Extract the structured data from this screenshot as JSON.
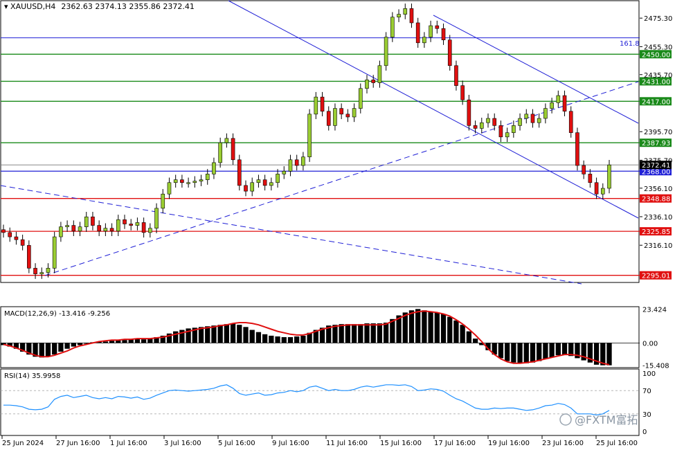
{
  "header": {
    "symbol": "XAUUSD,H4",
    "ohlc": "2362.63 2374.13 2355.86 2372.41"
  },
  "price_axis": {
    "ticks": [
      "2475.30",
      "2455.30",
      "2435.70",
      "2395.70",
      "2375.70",
      "2356.10",
      "2336.10",
      "2316.10"
    ],
    "tick_values": [
      2475.3,
      2455.3,
      2435.7,
      2395.7,
      2375.7,
      2356.1,
      2336.1,
      2316.1
    ]
  },
  "levels": [
    {
      "label": "2450.00",
      "value": 2450.0,
      "color": "#1a8a1a"
    },
    {
      "label": "2431.00",
      "value": 2431.0,
      "color": "#1a8a1a"
    },
    {
      "label": "2417.00",
      "value": 2417.0,
      "color": "#1a8a1a"
    },
    {
      "label": "2387.93",
      "value": 2387.93,
      "color": "#1a8a1a"
    },
    {
      "label": "2368.00",
      "value": 2368.0,
      "color": "#1f1fd6"
    },
    {
      "label": "2348.88",
      "value": 2348.88,
      "color": "#e01010"
    },
    {
      "label": "2325.85",
      "value": 2325.85,
      "color": "#e01010"
    },
    {
      "label": "2295.01",
      "value": 2295.01,
      "color": "#e01010"
    }
  ],
  "current_price": {
    "label": "2372.41",
    "value": 2372.41
  },
  "fib": {
    "label": "161.8",
    "value": 2461.5
  },
  "macd": {
    "label": "MACD(12,26,9) -13.416 -9.256",
    "ticks": [
      "23.424",
      "0.00",
      "-15.408"
    ],
    "tick_values": [
      23.424,
      0,
      -15.408
    ]
  },
  "rsi": {
    "label": "RSI(14) 35.9958",
    "ticks": [
      "100",
      "70",
      "30",
      "0"
    ],
    "tick_values": [
      100,
      70,
      30,
      0
    ],
    "color": "#1e90ff"
  },
  "time_axis": {
    "labels": [
      "25 Jun 2024",
      "27 Jun 16:00",
      "1 Jul 16:00",
      "3 Jul 16:00",
      "5 Jul 16:00",
      "9 Jul 16:00",
      "11 Jul 16:00",
      "15 Jul 16:00",
      "17 Jul 16:00",
      "19 Jul 16:00",
      "23 Jul 16:00",
      "25 Jul 16:00"
    ]
  },
  "watermark": "@FXTM富拓",
  "colors": {
    "bull": "#9acd32",
    "bear": "#e01010",
    "trendline": "#1f1fd6",
    "signal": "#e01010",
    "hist": "#000000"
  },
  "chart_data": {
    "type": "candlestick",
    "price_close": [
      2325,
      2322,
      2320,
      2316,
      2300,
      2296,
      2297,
      2300,
      2322,
      2329,
      2330,
      2326,
      2329,
      2336,
      2330,
      2326,
      2328,
      2326,
      2334,
      2331,
      2330,
      2332,
      2325,
      2328,
      2342,
      2352,
      2360,
      2362,
      2360,
      2360,
      2361,
      2362,
      2366,
      2374,
      2388,
      2391,
      2376,
      2358,
      2354,
      2360,
      2362,
      2358,
      2360,
      2366,
      2368,
      2376,
      2372,
      2378,
      2408,
      2420,
      2410,
      2400,
      2412,
      2408,
      2406,
      2412,
      2426,
      2432,
      2430,
      2442,
      2462,
      2476,
      2478,
      2482,
      2472,
      2458,
      2462,
      2470,
      2468,
      2460,
      2442,
      2428,
      2418,
      2400,
      2398,
      2402,
      2405,
      2400,
      2392,
      2395,
      2400,
      2405,
      2408,
      2402,
      2405,
      2412,
      2416,
      2421,
      2410,
      2395,
      2372,
      2366,
      2360,
      2352,
      2356,
      2372.41
    ],
    "macd_hist": [
      -1.5,
      -2.5,
      -4,
      -6,
      -8,
      -9.5,
      -10,
      -9.5,
      -8,
      -6,
      -4,
      -2.5,
      -1.5,
      -0.5,
      0.5,
      1,
      1,
      1.5,
      2,
      2,
      2.5,
      3,
      2.5,
      3,
      4,
      5,
      6.5,
      8,
      9,
      10,
      10.5,
      11,
      11.5,
      12,
      12.5,
      13,
      13.5,
      12.5,
      11,
      9,
      7.5,
      6,
      5,
      4.5,
      4,
      4,
      4.5,
      5,
      7,
      9,
      10.5,
      12,
      12.5,
      13,
      13,
      13,
      13,
      13.5,
      13.5,
      13.5,
      14,
      16.5,
      19,
      21,
      22.5,
      23.4,
      22.5,
      21.5,
      21,
      20,
      18,
      15.5,
      12.5,
      8,
      3,
      -1.5,
      -5,
      -8,
      -10.5,
      -12.5,
      -13.5,
      -14,
      -14,
      -13.5,
      -12.5,
      -11,
      -10,
      -8.5,
      -8,
      -9,
      -10.5,
      -12,
      -13.5,
      -15,
      -15.4,
      -15.4
    ],
    "macd_signal": [
      -1,
      -2,
      -3.5,
      -5,
      -7,
      -8.5,
      -9.5,
      -9.5,
      -8.5,
      -7,
      -5.5,
      -3.5,
      -2,
      -1,
      0,
      1,
      1.5,
      2,
      2,
      2.5,
      2.5,
      3,
      3,
      3,
      3.5,
      4,
      5,
      6,
      7,
      8,
      9,
      10,
      10.5,
      11,
      12,
      12.5,
      13.5,
      14,
      14,
      13.5,
      12.5,
      11,
      9.5,
      8,
      7,
      6,
      5.5,
      5.5,
      6.5,
      8,
      9.5,
      10.5,
      11.5,
      12,
      12.5,
      12.5,
      12.5,
      12.5,
      12.5,
      12.5,
      13,
      15,
      17,
      19,
      20.5,
      21.5,
      22,
      21.5,
      21,
      20,
      18.5,
      16,
      13,
      9.5,
      5.5,
      1,
      -4,
      -8,
      -11,
      -13,
      -14,
      -14,
      -13.5,
      -13,
      -12,
      -11,
      -10,
      -9,
      -8,
      -8,
      -8.5,
      -9.5,
      -11,
      -12.5,
      -14,
      -15
    ],
    "rsi": [
      45,
      45,
      44,
      42,
      38,
      37,
      38,
      42,
      55,
      60,
      62,
      58,
      60,
      62,
      58,
      56,
      58,
      56,
      60,
      59,
      57,
      59,
      55,
      57,
      62,
      66,
      70,
      71,
      70,
      69,
      70,
      71,
      72,
      74,
      78,
      80,
      74,
      65,
      62,
      64,
      66,
      62,
      63,
      66,
      67,
      70,
      68,
      70,
      76,
      78,
      74,
      70,
      72,
      70,
      70,
      72,
      76,
      78,
      76,
      78,
      80,
      80,
      79,
      80,
      77,
      70,
      71,
      73,
      72,
      69,
      62,
      56,
      52,
      46,
      40,
      38,
      38,
      40,
      39,
      40,
      40,
      38,
      36,
      37,
      40,
      44,
      45,
      48,
      46,
      40,
      30,
      30,
      30,
      28,
      30,
      36
    ]
  }
}
